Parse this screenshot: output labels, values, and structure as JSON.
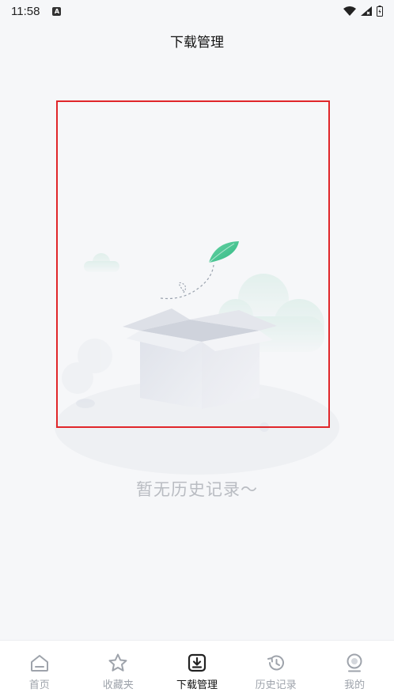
{
  "status_bar": {
    "time": "11:58",
    "notification_icon": "A",
    "icons": [
      "wifi-icon",
      "signal-icon",
      "battery-icon"
    ]
  },
  "header": {
    "title": "下载管理"
  },
  "empty_state": {
    "message": "暂无历史记录～",
    "illustration": "empty-box-illustration",
    "highlight_color": "#e0262a"
  },
  "tabbar": {
    "active_index": 2,
    "items": [
      {
        "label": "首页",
        "icon": "home-icon"
      },
      {
        "label": "收藏夹",
        "icon": "star-icon"
      },
      {
        "label": "下载管理",
        "icon": "download-icon"
      },
      {
        "label": "历史记录",
        "icon": "history-icon"
      },
      {
        "label": "我的",
        "icon": "profile-icon"
      }
    ]
  }
}
